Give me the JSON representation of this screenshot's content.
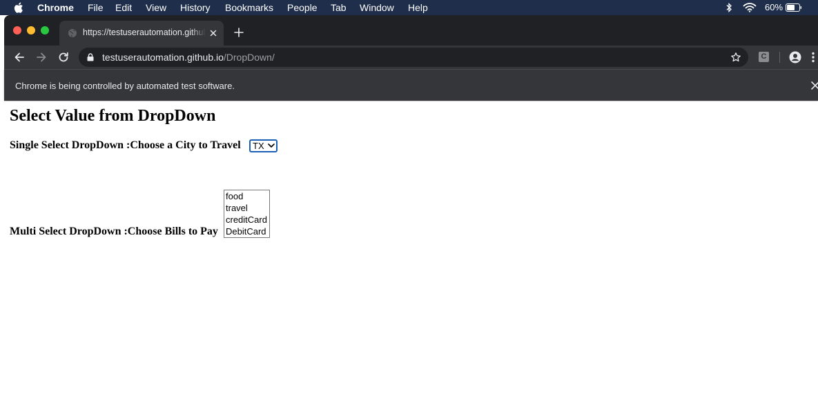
{
  "menubar": {
    "app_name": "Chrome",
    "items": [
      "File",
      "Edit",
      "View",
      "History",
      "Bookmarks",
      "People",
      "Tab",
      "Window",
      "Help"
    ],
    "battery_percent": "60%"
  },
  "browser": {
    "tab": {
      "title": "https://testuserautomation.github.io/DropDown/"
    },
    "omnibox": {
      "host": "testuserautomation.github.io",
      "path": "/DropDown/"
    },
    "extension_label": "C",
    "infobar_text": "Chrome is being controlled by automated test software."
  },
  "page": {
    "title": "Select Value from DropDown",
    "single_select": {
      "label": "Single Select DropDown :Choose a City to Travel",
      "selected_value": "TX"
    },
    "multi_select": {
      "label": "Multi Select DropDown :Choose Bills to Pay",
      "options": [
        "food",
        "travel",
        "creditCard",
        "DebitCard"
      ]
    }
  },
  "icons": {
    "apple": "apple-icon",
    "globe": "globe-icon",
    "close": "close-icon",
    "new_tab": "plus-icon",
    "back": "arrow-left-icon",
    "forward": "arrow-right-icon",
    "reload": "reload-icon",
    "lock": "lock-icon",
    "star": "star-icon",
    "profile": "profile-icon",
    "menu": "kebab-menu-icon",
    "wifi": "wifi-icon",
    "battery": "battery-icon",
    "bluetooth": "bluetooth-icon"
  }
}
